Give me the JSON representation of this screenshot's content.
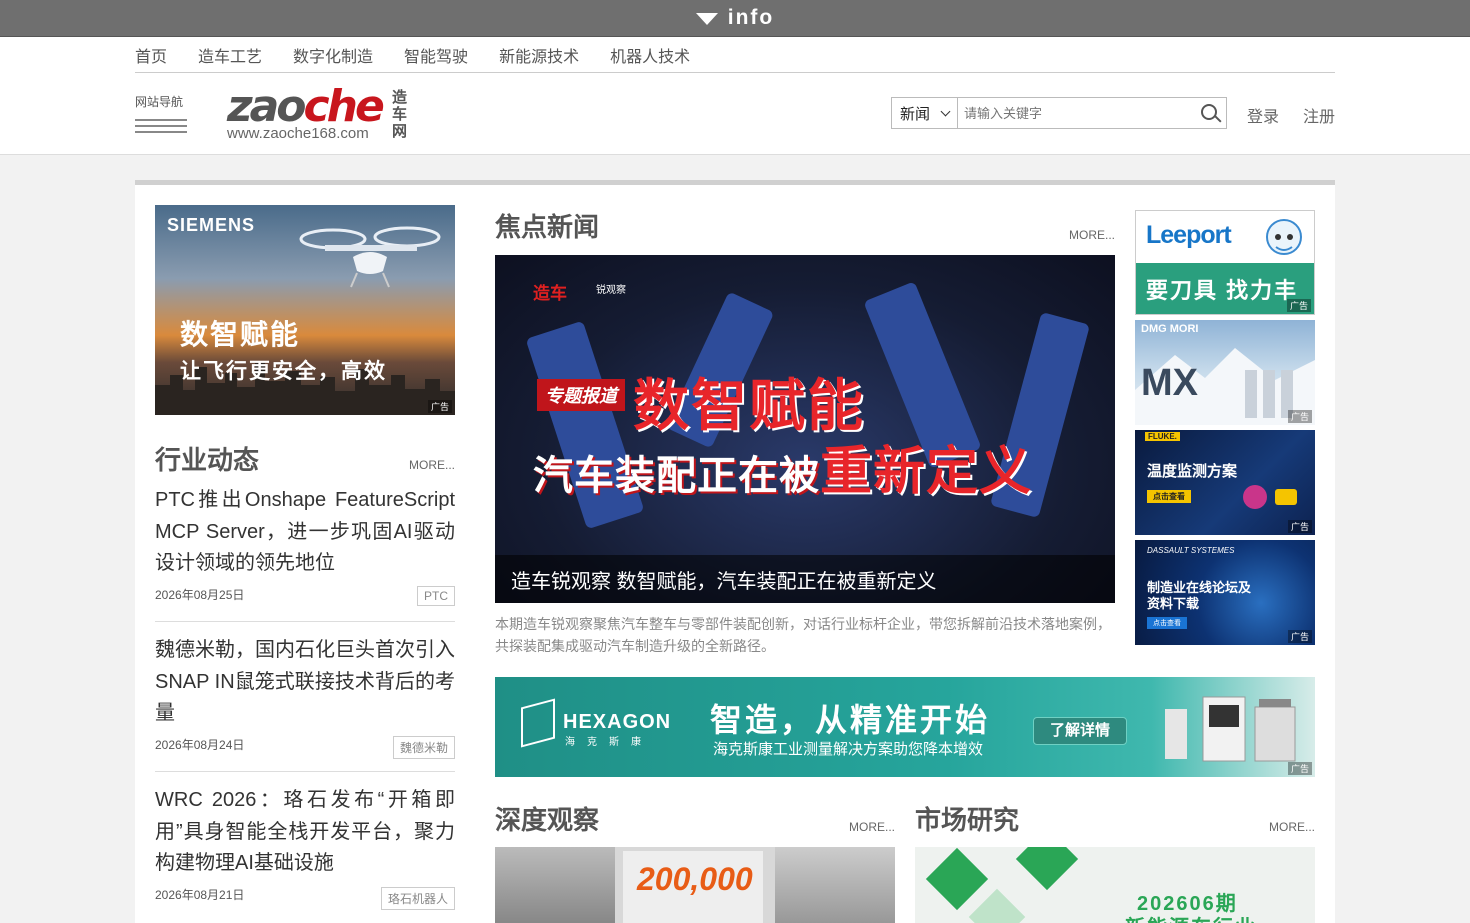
{
  "infobar": {
    "label": "info"
  },
  "catnav": {
    "items": [
      "首页",
      "造车工艺",
      "数字化制造",
      "智能驾驶",
      "新能源技术",
      "机器人技术"
    ]
  },
  "sitenav": {
    "label": "网站导航"
  },
  "logo": {
    "brand_main": "zao",
    "brand_accent": "che",
    "url": "www.zaoche168.com",
    "cn": "造车网"
  },
  "search": {
    "category": "新闻",
    "placeholder": "请输入关键字"
  },
  "auth": {
    "login": "登录",
    "register": "注册"
  },
  "ads": {
    "label": "广告",
    "siemens": {
      "brand": "SIEMENS",
      "line1": "数智赋能",
      "line2": "让飞行更安全，高效"
    },
    "leeport": {
      "brand": "Leeport",
      "slogan": "要刀具 找力丰"
    },
    "dmg": {
      "brand": "DMG MORI",
      "mark": "MX"
    },
    "fluke": {
      "brand": "FLUKE.",
      "text": "温度监测方案",
      "btn": "点击查看"
    },
    "dassault": {
      "brand": "DASSAULT SYSTEMES",
      "text1": "制造业在线论坛及",
      "text2": "资料下载",
      "btn": "点击查看"
    },
    "hexagon": {
      "brand": "HEXAGON",
      "brand_cn": "海克斯康",
      "headline": "智造，从精准开始",
      "sub": "海克斯康工业测量解决方案助您降本增效",
      "btn": "了解详情"
    }
  },
  "industry": {
    "title": "行业动态",
    "more": "MORE...",
    "items": [
      {
        "title": "PTC推出Onshape FeatureScript MCP Server，进一步巩固AI驱动设计领域的领先地位",
        "date": "2026年08月25日",
        "tag": "PTC"
      },
      {
        "title": "魏德米勒，国内石化巨头首次引入SNAP IN鼠笼式联接技术背后的考量",
        "date": "2026年08月24日",
        "tag": "魏德米勒"
      },
      {
        "title": "WRC 2026：珞石发布“开箱即用”具身智能全栈开发平台，聚力构建物理AI基础设施",
        "date": "2026年08月21日",
        "tag": "珞石机器人"
      }
    ]
  },
  "focus": {
    "title": "焦点新闻",
    "more": "MORE...",
    "img_logo": "造车",
    "img_logo_sub": "锐观察",
    "img_tag": "专题报道",
    "img_h1": "数智赋能",
    "img_h2a": "汽车装配正在被",
    "img_h2b": "重新定义",
    "caption": "造车锐观察 数智赋能，汽车装配正在被重新定义",
    "desc": "本期造车锐观察聚焦汽车整车与零部件装配创新，对话行业标杆企业，带您拆解前沿技术落地案例，共探装配集成驱动汽车制造升级的全新路径。"
  },
  "depth": {
    "title": "深度观察",
    "more": "MORE...",
    "img_text": "200,000"
  },
  "market": {
    "title": "市场研究",
    "more": "MORE...",
    "img_text1": "202606期",
    "img_text2": "新能源车行业"
  }
}
